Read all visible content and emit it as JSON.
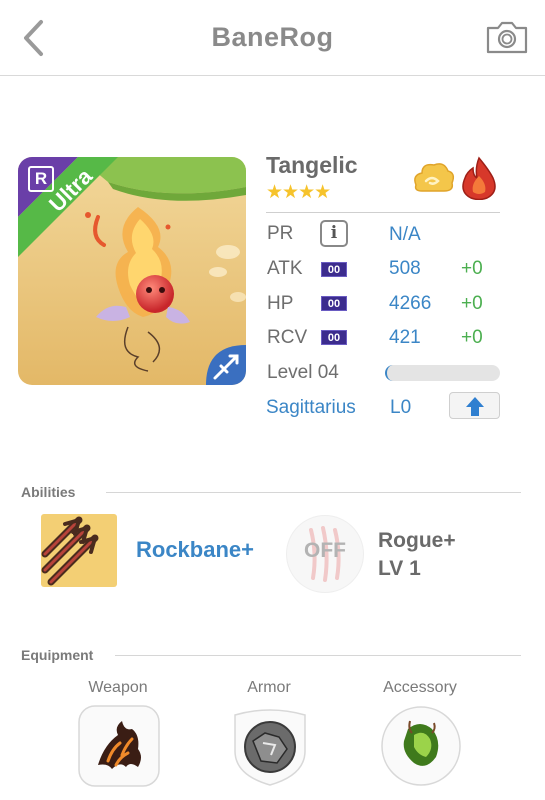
{
  "nav": {
    "title": "BaneRog",
    "back_icon": "chevron-left-icon",
    "camera_icon": "camera-icon"
  },
  "monster": {
    "name": "Tangelic",
    "stars": "★★★★",
    "star_count": 4,
    "rank_letter": "R",
    "rarity": "Ultra",
    "element_icons": [
      "cloud-element-icon",
      "fire-element-icon"
    ],
    "class_icon": "sagittarius-arrow-icon"
  },
  "stats": {
    "pr": {
      "label": "PR",
      "value": "N/A"
    },
    "atk": {
      "label": "ATK",
      "badge": "00",
      "value": "508",
      "bonus": "+0"
    },
    "hp": {
      "label": "HP",
      "badge": "00",
      "value": "4266",
      "bonus": "+0"
    },
    "rcv": {
      "label": "RCV",
      "badge": "00",
      "value": "421",
      "bonus": "+0"
    },
    "level": {
      "label": "Level 04",
      "progress": 0.02
    },
    "zodiac": {
      "name": "Sagittarius",
      "level": "L0"
    }
  },
  "abilities": {
    "section_label": "Abilities",
    "active": {
      "name": "Rockbane+"
    },
    "passive": {
      "status": "OFF",
      "name_line1": "Rogue+",
      "name_line2": "LV 1"
    }
  },
  "equipment": {
    "section_label": "Equipment",
    "slots": [
      {
        "label": "Weapon",
        "icon": "lava-claw-weapon-icon"
      },
      {
        "label": "Armor",
        "icon": "stone-shield-armor-icon"
      },
      {
        "label": "Accessory",
        "icon": "green-gem-accessory-icon"
      }
    ]
  },
  "colors": {
    "accent_blue": "#3b86c6",
    "bonus_green": "#4caf50",
    "star_gold": "#f6c32c",
    "ribbon_green": "#56b947",
    "rank_purple": "#6a3fa8"
  }
}
